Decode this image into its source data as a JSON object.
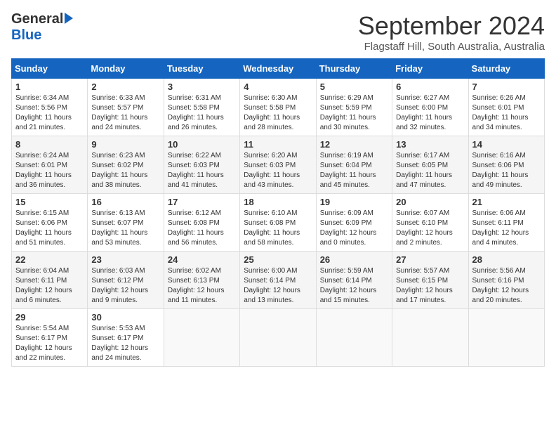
{
  "logo": {
    "general": "General",
    "blue": "Blue"
  },
  "title": "September 2024",
  "location": "Flagstaff Hill, South Australia, Australia",
  "weekdays": [
    "Sunday",
    "Monday",
    "Tuesday",
    "Wednesday",
    "Thursday",
    "Friday",
    "Saturday"
  ],
  "weeks": [
    [
      {
        "day": "1",
        "sunrise": "6:34 AM",
        "sunset": "5:56 PM",
        "daylight": "11 hours and 21 minutes."
      },
      {
        "day": "2",
        "sunrise": "6:33 AM",
        "sunset": "5:57 PM",
        "daylight": "11 hours and 24 minutes."
      },
      {
        "day": "3",
        "sunrise": "6:31 AM",
        "sunset": "5:58 PM",
        "daylight": "11 hours and 26 minutes."
      },
      {
        "day": "4",
        "sunrise": "6:30 AM",
        "sunset": "5:58 PM",
        "daylight": "11 hours and 28 minutes."
      },
      {
        "day": "5",
        "sunrise": "6:29 AM",
        "sunset": "5:59 PM",
        "daylight": "11 hours and 30 minutes."
      },
      {
        "day": "6",
        "sunrise": "6:27 AM",
        "sunset": "6:00 PM",
        "daylight": "11 hours and 32 minutes."
      },
      {
        "day": "7",
        "sunrise": "6:26 AM",
        "sunset": "6:01 PM",
        "daylight": "11 hours and 34 minutes."
      }
    ],
    [
      {
        "day": "8",
        "sunrise": "6:24 AM",
        "sunset": "6:01 PM",
        "daylight": "11 hours and 36 minutes."
      },
      {
        "day": "9",
        "sunrise": "6:23 AM",
        "sunset": "6:02 PM",
        "daylight": "11 hours and 38 minutes."
      },
      {
        "day": "10",
        "sunrise": "6:22 AM",
        "sunset": "6:03 PM",
        "daylight": "11 hours and 41 minutes."
      },
      {
        "day": "11",
        "sunrise": "6:20 AM",
        "sunset": "6:03 PM",
        "daylight": "11 hours and 43 minutes."
      },
      {
        "day": "12",
        "sunrise": "6:19 AM",
        "sunset": "6:04 PM",
        "daylight": "11 hours and 45 minutes."
      },
      {
        "day": "13",
        "sunrise": "6:17 AM",
        "sunset": "6:05 PM",
        "daylight": "11 hours and 47 minutes."
      },
      {
        "day": "14",
        "sunrise": "6:16 AM",
        "sunset": "6:06 PM",
        "daylight": "11 hours and 49 minutes."
      }
    ],
    [
      {
        "day": "15",
        "sunrise": "6:15 AM",
        "sunset": "6:06 PM",
        "daylight": "11 hours and 51 minutes."
      },
      {
        "day": "16",
        "sunrise": "6:13 AM",
        "sunset": "6:07 PM",
        "daylight": "11 hours and 53 minutes."
      },
      {
        "day": "17",
        "sunrise": "6:12 AM",
        "sunset": "6:08 PM",
        "daylight": "11 hours and 56 minutes."
      },
      {
        "day": "18",
        "sunrise": "6:10 AM",
        "sunset": "6:08 PM",
        "daylight": "11 hours and 58 minutes."
      },
      {
        "day": "19",
        "sunrise": "6:09 AM",
        "sunset": "6:09 PM",
        "daylight": "12 hours and 0 minutes."
      },
      {
        "day": "20",
        "sunrise": "6:07 AM",
        "sunset": "6:10 PM",
        "daylight": "12 hours and 2 minutes."
      },
      {
        "day": "21",
        "sunrise": "6:06 AM",
        "sunset": "6:11 PM",
        "daylight": "12 hours and 4 minutes."
      }
    ],
    [
      {
        "day": "22",
        "sunrise": "6:04 AM",
        "sunset": "6:11 PM",
        "daylight": "12 hours and 6 minutes."
      },
      {
        "day": "23",
        "sunrise": "6:03 AM",
        "sunset": "6:12 PM",
        "daylight": "12 hours and 9 minutes."
      },
      {
        "day": "24",
        "sunrise": "6:02 AM",
        "sunset": "6:13 PM",
        "daylight": "12 hours and 11 minutes."
      },
      {
        "day": "25",
        "sunrise": "6:00 AM",
        "sunset": "6:14 PM",
        "daylight": "12 hours and 13 minutes."
      },
      {
        "day": "26",
        "sunrise": "5:59 AM",
        "sunset": "6:14 PM",
        "daylight": "12 hours and 15 minutes."
      },
      {
        "day": "27",
        "sunrise": "5:57 AM",
        "sunset": "6:15 PM",
        "daylight": "12 hours and 17 minutes."
      },
      {
        "day": "28",
        "sunrise": "5:56 AM",
        "sunset": "6:16 PM",
        "daylight": "12 hours and 20 minutes."
      }
    ],
    [
      {
        "day": "29",
        "sunrise": "5:54 AM",
        "sunset": "6:17 PM",
        "daylight": "12 hours and 22 minutes."
      },
      {
        "day": "30",
        "sunrise": "5:53 AM",
        "sunset": "6:17 PM",
        "daylight": "12 hours and 24 minutes."
      },
      null,
      null,
      null,
      null,
      null
    ]
  ],
  "labels": {
    "sunrise": "Sunrise:",
    "sunset": "Sunset:",
    "daylight": "Daylight:"
  }
}
